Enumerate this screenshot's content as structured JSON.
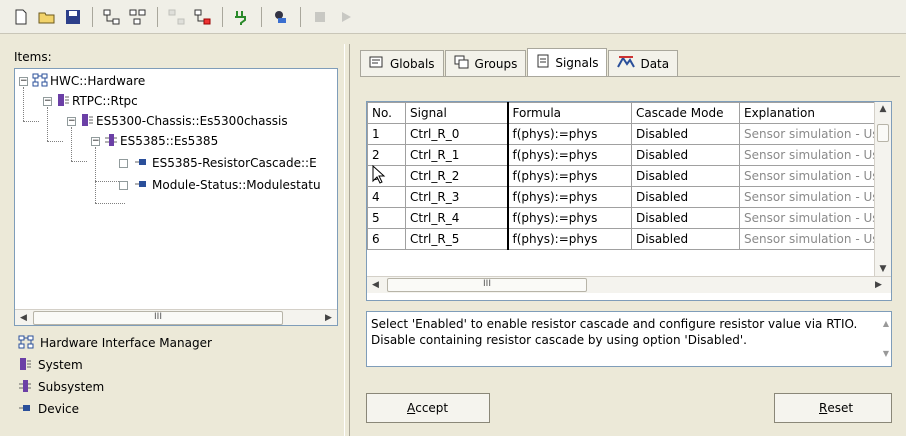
{
  "toolbar": {
    "buttons": [
      "new-file-icon",
      "open-folder-icon",
      "save-icon",
      "hierarchy-icon",
      "hierarchy-alt-icon",
      "tree-disabled-icon",
      "tree-red-icon",
      "connect-icon",
      "run-icon",
      "stop-icon",
      "play-icon"
    ]
  },
  "left": {
    "items_label": "Items:",
    "tree": [
      {
        "label": "HWC::Hardware"
      },
      {
        "label": "RTPC::Rtpc"
      },
      {
        "label": "ES5300-Chassis::Es5300chassis"
      },
      {
        "label": "ES5385::Es5385"
      },
      {
        "label": "ES5385-ResistorCascade::E"
      },
      {
        "label": "Module-Status::Modulestatu"
      }
    ],
    "scroll_thumb": "III",
    "legend": [
      {
        "label": "Hardware Interface Manager",
        "icon": "hardware-interface-manager-icon"
      },
      {
        "label": "System",
        "icon": "system-icon"
      },
      {
        "label": "Subsystem",
        "icon": "subsystem-icon"
      },
      {
        "label": "Device",
        "icon": "device-icon"
      }
    ]
  },
  "tabs": [
    {
      "label": "Globals",
      "icon": "globals-icon"
    },
    {
      "label": "Groups",
      "icon": "groups-icon"
    },
    {
      "label": "Signals",
      "icon": "signals-icon",
      "active": true
    },
    {
      "label": "Data",
      "icon": "data-icon"
    }
  ],
  "grid": {
    "headers": [
      "No.",
      "Signal",
      "Formula",
      "Cascade Mode",
      "Explanation"
    ],
    "rows": [
      [
        "1",
        "Ctrl_R_0",
        "f(phys):=phys",
        "Disabled",
        "Sensor simulation - Us"
      ],
      [
        "2",
        "Ctrl_R_1",
        "f(phys):=phys",
        "Disabled",
        "Sensor simulation - Us"
      ],
      [
        "3",
        "Ctrl_R_2",
        "f(phys):=phys",
        "Disabled",
        "Sensor simulation - Us"
      ],
      [
        "4",
        "Ctrl_R_3",
        "f(phys):=phys",
        "Disabled",
        "Sensor simulation - Us"
      ],
      [
        "5",
        "Ctrl_R_4",
        "f(phys):=phys",
        "Disabled",
        "Sensor simulation - Us"
      ],
      [
        "6",
        "Ctrl_R_5",
        "f(phys):=phys",
        "Disabled",
        "Sensor simulation - Us"
      ]
    ],
    "scroll_thumb": "III"
  },
  "info_text": "Select 'Enabled' to enable resistor cascade and configure resistor value via RTIO. Disable containing resistor cascade by using option 'Disabled'.",
  "buttons": {
    "accept_prefix": "A",
    "accept_rest": "ccept",
    "reset_prefix": "R",
    "reset_rest": "eset"
  }
}
